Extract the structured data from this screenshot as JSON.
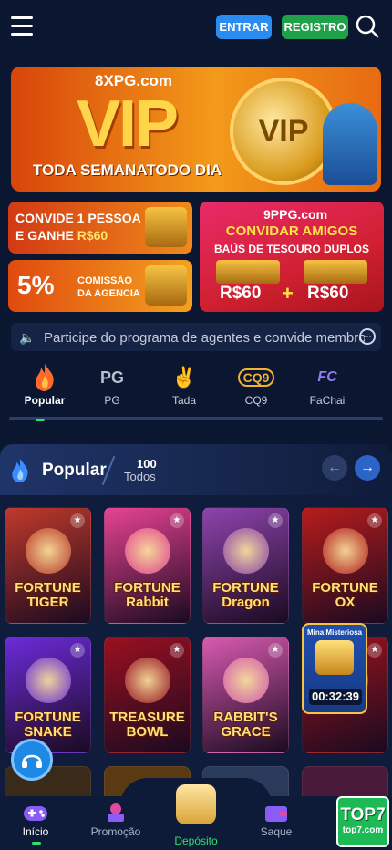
{
  "header": {
    "login_label": "ENTRAR",
    "register_label": "REGISTRO"
  },
  "vip_banner": {
    "brand": "8XPG.com",
    "title": "VIP",
    "subtitle": "TODA SEMANATODO DIA",
    "coin_text": "VIP"
  },
  "promos": {
    "invite": {
      "line1": "CONVIDE 1 PESSOA",
      "line2_prefix": "E GANHE",
      "amount": "R$60"
    },
    "commission": {
      "big": "5%",
      "line1": "COMISSÃO",
      "line2": "DA AGENCIA"
    },
    "friends": {
      "brand": "9PPG.com",
      "title": "CONVIDAR AMIGOS",
      "subtitle": "BAÚS DE TESOURO DUPLOS",
      "reward_left": "R$60",
      "plus": "+",
      "reward_right": "R$60"
    }
  },
  "marquee": {
    "text": "Participe do programa de agentes e convide membros"
  },
  "categories": [
    {
      "label": "Popular",
      "icon": "flame-icon",
      "active": true
    },
    {
      "label": "PG",
      "icon": "pg-logo-icon",
      "active": false
    },
    {
      "label": "Tada",
      "icon": "tada-logo-icon",
      "active": false
    },
    {
      "label": "CQ9",
      "icon": "cq9-logo-icon",
      "active": false
    },
    {
      "label": "FaChai",
      "icon": "fachai-logo-icon",
      "active": false
    }
  ],
  "popular": {
    "title": "Popular",
    "count": "100",
    "all_label": "Todos"
  },
  "games": [
    {
      "name": "FORTUNE TIGER",
      "bg": "#c0392b"
    },
    {
      "name": "FORTUNE Rabbit",
      "bg": "#e84393"
    },
    {
      "name": "FORTUNE Dragon",
      "bg": "#8e44ad"
    },
    {
      "name": "FORTUNE OX",
      "bg": "#b71c1c"
    },
    {
      "name": "FORTUNE SNAKE",
      "bg": "#6c2bd9"
    },
    {
      "name": "TREASURE BOWL",
      "bg": "#9b1020"
    },
    {
      "name": "RABBIT'S GRACE",
      "bg": "#d85ab0"
    },
    {
      "name": "",
      "bg": "#a0141c"
    }
  ],
  "mina": {
    "title": "Mina Misteriosa",
    "timer": "00:32:39"
  },
  "bottom_nav": [
    {
      "label": "Início",
      "icon": "gamepad-icon",
      "active": true
    },
    {
      "label": "Promoção",
      "icon": "gift-icon",
      "active": false
    },
    {
      "label": "Depósito",
      "icon": "money-bag-icon",
      "active": false
    },
    {
      "label": "Saque",
      "icon": "wallet-icon",
      "active": false
    }
  ],
  "top7": {
    "logo": "TOP7",
    "domain": "top7.com"
  }
}
